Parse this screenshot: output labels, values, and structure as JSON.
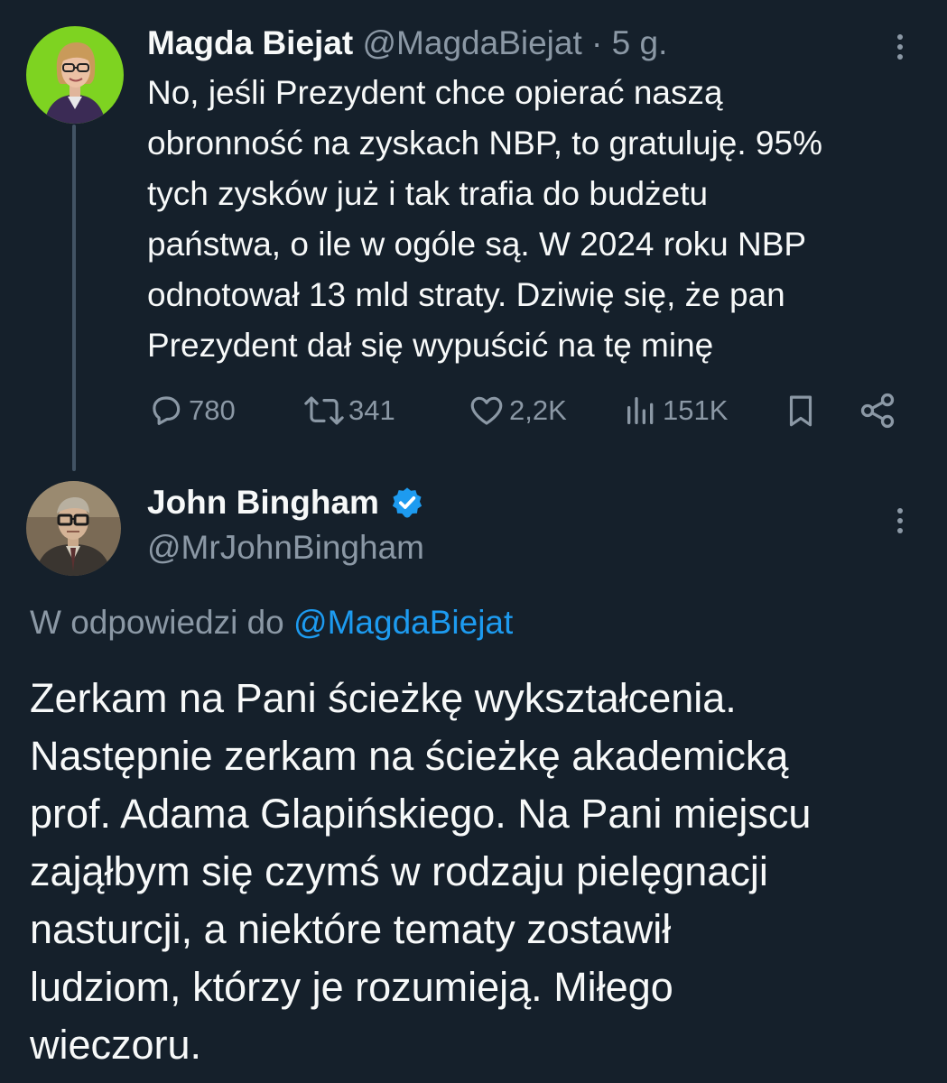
{
  "tweet1": {
    "author_name": "Magda Biejat",
    "handle": "@MagdaBiejat",
    "separator": "·",
    "time": "5 g.",
    "text": "No, jeśli Prezydent chce opierać naszą\nobronność na zyskach NBP, to gratuluję. 95%\ntych zysków już i tak trafia do budżetu\npaństwa, o ile w ogóle są. W 2024 roku NBP\nodnotował 13 mld straty. Dziwię się, że pan\nPrezydent dał się wypuścić na tę minę",
    "avatar_bg": "#7ed321",
    "actions": {
      "replies": "780",
      "reposts": "341",
      "likes": "2,2K",
      "views": "151K"
    }
  },
  "tweet2": {
    "author_name": "John Bingham",
    "verified": true,
    "handle": "@MrJohnBingham",
    "reply_prefix": "W odpowiedzi do",
    "reply_handle": "@MagdaBiejat",
    "text": "Zerkam na Pani ścieżkę wykształcenia.\nNastępnie zerkam na ścieżkę akademicką\nprof. Adama Glapińskiego. Na Pani miejscu\nzająłbym się czymś w rodzaju pielęgnacji\nnasturcji, a niektóre tematy zostawił\nludziom, którzy je rozumieją. Miłego\nwieczoru."
  },
  "colors": {
    "background": "#15202b",
    "text": "#f7f9f9",
    "muted": "#8b98a5",
    "accent": "#1d9bf0",
    "thread_line": "#425364"
  },
  "icons": [
    "reply-icon",
    "repost-icon",
    "like-icon",
    "views-icon",
    "bookmark-icon",
    "share-icon",
    "verified-badge-icon",
    "more-options-icon"
  ]
}
